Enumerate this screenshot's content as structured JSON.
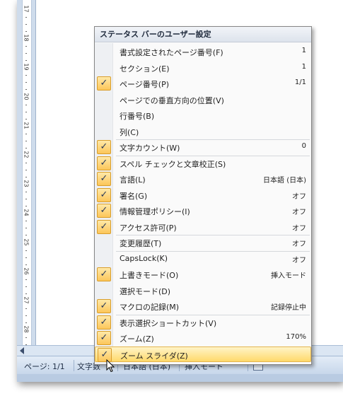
{
  "ruler": {
    "numbers": [
      "17",
      "18",
      "19",
      "20",
      "21",
      "22",
      "23",
      "24",
      "25",
      "26",
      "27",
      "28"
    ]
  },
  "statusbar": {
    "page": "ページ: 1/1",
    "wordcount": "文字数",
    "language": "日本語 (日本)",
    "insert_mode": "挿入モード"
  },
  "menu": {
    "title": "ステータス バーのユーザー設定",
    "items": [
      {
        "label": "書式設定されたページ番号(F)",
        "value": "1",
        "checked": false
      },
      {
        "label": "セクション(E)",
        "value": "1",
        "checked": false
      },
      {
        "label": "ページ番号(P)",
        "value": "1/1",
        "checked": true
      },
      {
        "label": "ページでの垂直方向の位置(V)",
        "value": "",
        "checked": false
      },
      {
        "label": "行番号(B)",
        "value": "",
        "checked": false
      },
      {
        "label": "列(C)",
        "value": "",
        "checked": false
      },
      {
        "label": "文字カウント(W)",
        "value": "0",
        "checked": true
      },
      {
        "label": "スペル チェックと文章校正(S)",
        "value": "",
        "checked": true
      },
      {
        "label": "言語(L)",
        "value": "日本語 (日本)",
        "checked": true
      },
      {
        "label": "署名(G)",
        "value": "オフ",
        "checked": true
      },
      {
        "label": "情報管理ポリシー(I)",
        "value": "オフ",
        "checked": true
      },
      {
        "label": "アクセス許可(P)",
        "value": "オフ",
        "checked": true
      },
      {
        "label": "変更履歴(T)",
        "value": "オフ",
        "checked": false
      },
      {
        "label": "CapsLock(K)",
        "value": "オフ",
        "checked": false
      },
      {
        "label": "上書きモード(O)",
        "value": "挿入モード",
        "checked": true
      },
      {
        "label": "選択モード(D)",
        "value": "",
        "checked": false
      },
      {
        "label": "マクロの記録(M)",
        "value": "記録停止中",
        "checked": true
      },
      {
        "label": "表示選択ショートカット(V)",
        "value": "",
        "checked": true
      },
      {
        "label": "ズーム(Z)",
        "value": "170%",
        "checked": true
      },
      {
        "label": "ズーム スライダ(Z)",
        "value": "",
        "checked": true,
        "highlighted": true
      }
    ]
  },
  "colors": {
    "highlight": "#ffd96b",
    "check_bg": "#fcc65a",
    "statusbar": "#c6d6ea"
  }
}
